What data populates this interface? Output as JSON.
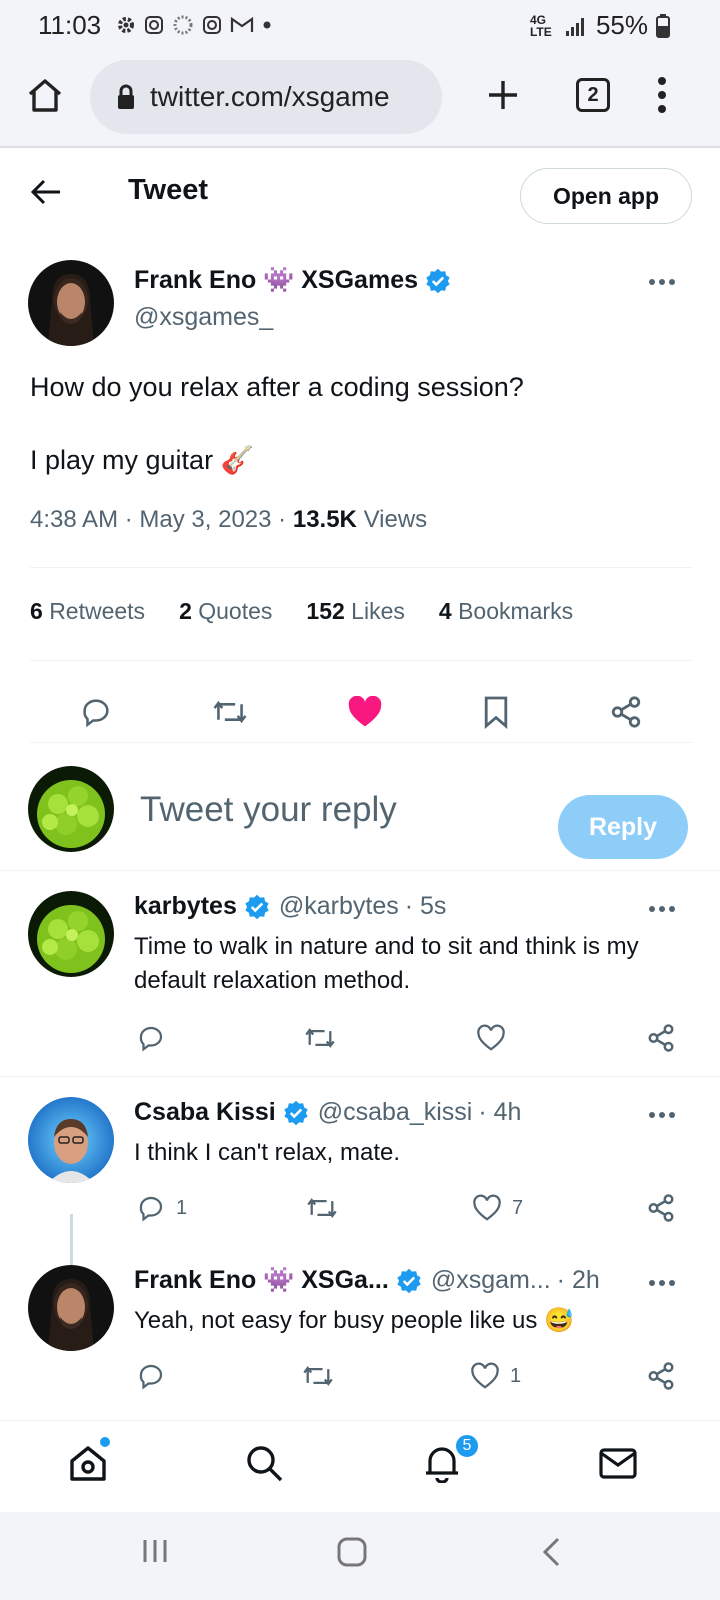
{
  "status_bar": {
    "time": "11:03",
    "network": "4G LTE",
    "battery": "55%"
  },
  "browser": {
    "url": "twitter.com/xsgame",
    "tab_count": "2"
  },
  "header": {
    "title": "Tweet",
    "open_app_label": "Open app"
  },
  "tweet": {
    "author_name": "Frank Eno 👾 XSGames",
    "author_handle": "@xsgames_",
    "text_line1": "How do you relax after a coding session?",
    "text_line2": "I play my guitar 🎸",
    "time": "4:38 AM",
    "date": "May 3, 2023",
    "views_count": "13.5K",
    "views_label": "Views",
    "retweets_count": "6",
    "retweets_label": "Retweets",
    "quotes_count": "2",
    "quotes_label": "Quotes",
    "likes_count": "152",
    "likes_label": "Likes",
    "bookmarks_count": "4",
    "bookmarks_label": "Bookmarks",
    "liked": true
  },
  "reply_box": {
    "placeholder": "Tweet your reply",
    "button_label": "Reply"
  },
  "replies": [
    {
      "name": "karbytes",
      "handle": "@karbytes",
      "age": "· 5s",
      "text": "Time to walk in nature and to sit and think is my default relaxation method.",
      "reply_count": "",
      "like_count": ""
    },
    {
      "name": "Csaba Kissi",
      "handle": "@csaba_kissi",
      "age": "· 4h",
      "text": "I think I can't relax, mate.",
      "reply_count": "1",
      "like_count": "7"
    },
    {
      "name": "Frank Eno 👾 XSGa...",
      "handle": "@xsgam...",
      "age": "· 2h",
      "text": "Yeah, not easy for busy people like us 😅",
      "reply_count": "",
      "like_count": "1"
    }
  ],
  "bottom_nav": {
    "notifications_badge": "5"
  },
  "colors": {
    "accent": "#1d9bf0",
    "like": "#f91880",
    "reply_button": "#8ecdf8",
    "secondary_text": "#536471"
  },
  "icons": [
    "home-icon",
    "lock-icon",
    "plus-icon",
    "more-vert-icon",
    "back-arrow-icon",
    "verified-badge-icon",
    "reply-icon",
    "retweet-icon",
    "heart-icon",
    "bookmark-icon",
    "share-icon",
    "search-icon",
    "bell-icon",
    "mail-icon"
  ]
}
